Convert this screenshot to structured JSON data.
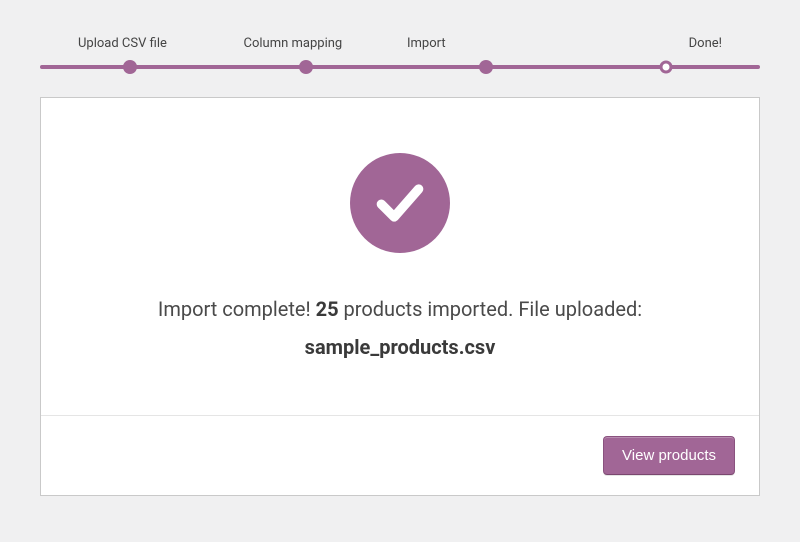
{
  "colors": {
    "accent": "#a16696"
  },
  "stepper": {
    "steps": [
      {
        "label": "Upload CSV file",
        "state": "done"
      },
      {
        "label": "Column mapping",
        "state": "done"
      },
      {
        "label": "Import",
        "state": "done"
      },
      {
        "label": "Done!",
        "state": "current"
      }
    ]
  },
  "result": {
    "icon": "check-circle-icon",
    "message_prefix": "Import complete! ",
    "count": "25",
    "message_mid": " products imported. File uploaded:",
    "filename": "sample_products.csv"
  },
  "actions": {
    "view_products_label": "View products"
  }
}
